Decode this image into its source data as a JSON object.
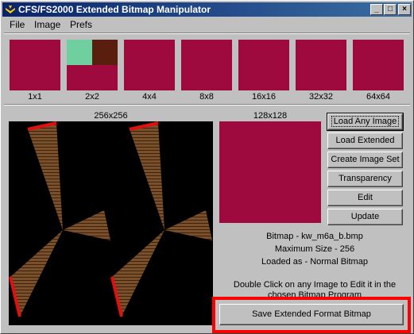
{
  "window": {
    "title": "CFS/FS2000 Extended Bitmap Manipulator"
  },
  "titlebar_buttons": {
    "minimize": "_",
    "maximize": "□",
    "close": "×"
  },
  "menu": [
    "File",
    "Image",
    "Prefs"
  ],
  "thumbnails": [
    "1x1",
    "2x2",
    "4x4",
    "8x8",
    "16x16",
    "32x32",
    "64x64"
  ],
  "panels": {
    "large_label": "256x256",
    "medium_label": "128x128"
  },
  "buttons": [
    "Load Any Image",
    "Load Extended",
    "Create Image Set",
    "Transparency",
    "Edit",
    "Update"
  ],
  "info": {
    "bitmap": "Bitmap - kw_m6a_b.bmp",
    "max_size": "Maximum Size - 256",
    "loaded_as": "Loaded as - Normal Bitmap",
    "hint": "Double Click on any Image to Edit it in the chosen Bitmap Program"
  },
  "save_button": "Save Extended Format Bitmap",
  "colors": {
    "swatch": "#9e0a3d",
    "teal": "#6fcf9f",
    "brown": "#5a1e0e",
    "highlight": "#ff0000"
  }
}
